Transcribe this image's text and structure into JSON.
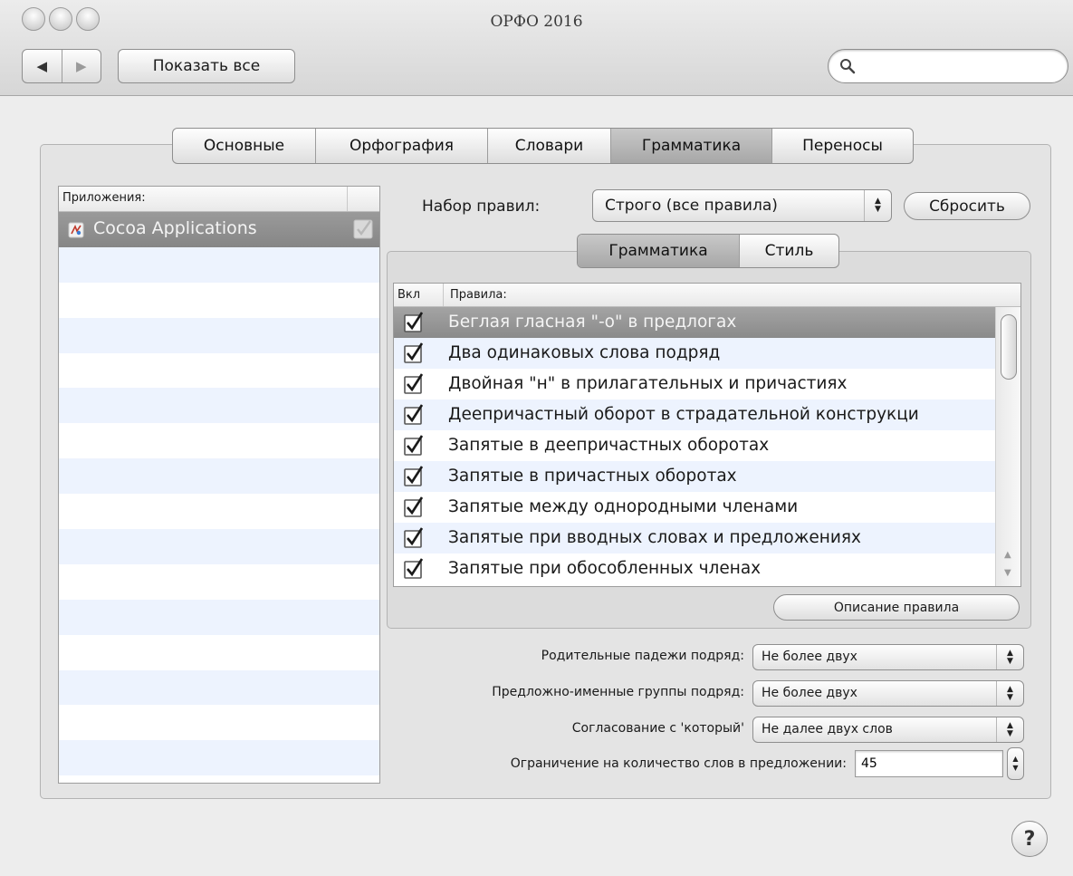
{
  "window": {
    "title": "ОРФО 2016"
  },
  "toolbar": {
    "back_glyph": "◀",
    "forward_glyph": "▶",
    "show_all_label": "Показать все",
    "search_value": ""
  },
  "tabs": [
    {
      "label": "Основные",
      "selected": false
    },
    {
      "label": "Орфография",
      "selected": false
    },
    {
      "label": "Словари",
      "selected": false
    },
    {
      "label": "Грамматика",
      "selected": true
    },
    {
      "label": "Переносы",
      "selected": false
    }
  ],
  "apps": {
    "header": "Приложения:",
    "items": [
      {
        "name": "Cocoa Applications",
        "enabled": true,
        "selected": true
      }
    ]
  },
  "ruleset": {
    "label": "Набор правил:",
    "value": "Строго (все правила)",
    "reset_label": "Сбросить"
  },
  "subtabs": [
    {
      "label": "Грамматика",
      "selected": true
    },
    {
      "label": "Стиль",
      "selected": false
    }
  ],
  "rules": {
    "col_on": "Вкл",
    "col_rules": "Правила:",
    "items": [
      {
        "text": "Беглая гласная \"-о\" в предлогах",
        "checked": true,
        "selected": true
      },
      {
        "text": "Два одинаковых слова подряд",
        "checked": true,
        "selected": false
      },
      {
        "text": "Двойная \"н\" в прилагательных и причастиях",
        "checked": true,
        "selected": false
      },
      {
        "text": "Деепричастный оборот в страдательной конструкци",
        "checked": true,
        "selected": false
      },
      {
        "text": "Запятые в деепричастных оборотах",
        "checked": true,
        "selected": false
      },
      {
        "text": "Запятые в причастных оборотах",
        "checked": true,
        "selected": false
      },
      {
        "text": "Запятые между однородными членами",
        "checked": true,
        "selected": false
      },
      {
        "text": "Запятые при вводных словах и предложениях",
        "checked": true,
        "selected": false
      },
      {
        "text": "Запятые при обособленных членах",
        "checked": true,
        "selected": false
      }
    ],
    "describe_label": "Описание правила"
  },
  "options": {
    "genitive_label": "Родительные падежи подряд:",
    "genitive_value": "Не более двух",
    "prep_label": "Предложно-именные группы подряд:",
    "prep_value": "Не более двух",
    "kotoryi_label": "Согласование с 'который'",
    "kotoryi_value": "Не далее двух слов",
    "limit_label": "Ограничение на количество слов в предложении:",
    "limit_value": "45"
  },
  "help_label": "?",
  "colors": {
    "selection_gray": "#8a8a8a",
    "alt_row": "#edf3fe",
    "check_mark": "#1a1a1a"
  }
}
